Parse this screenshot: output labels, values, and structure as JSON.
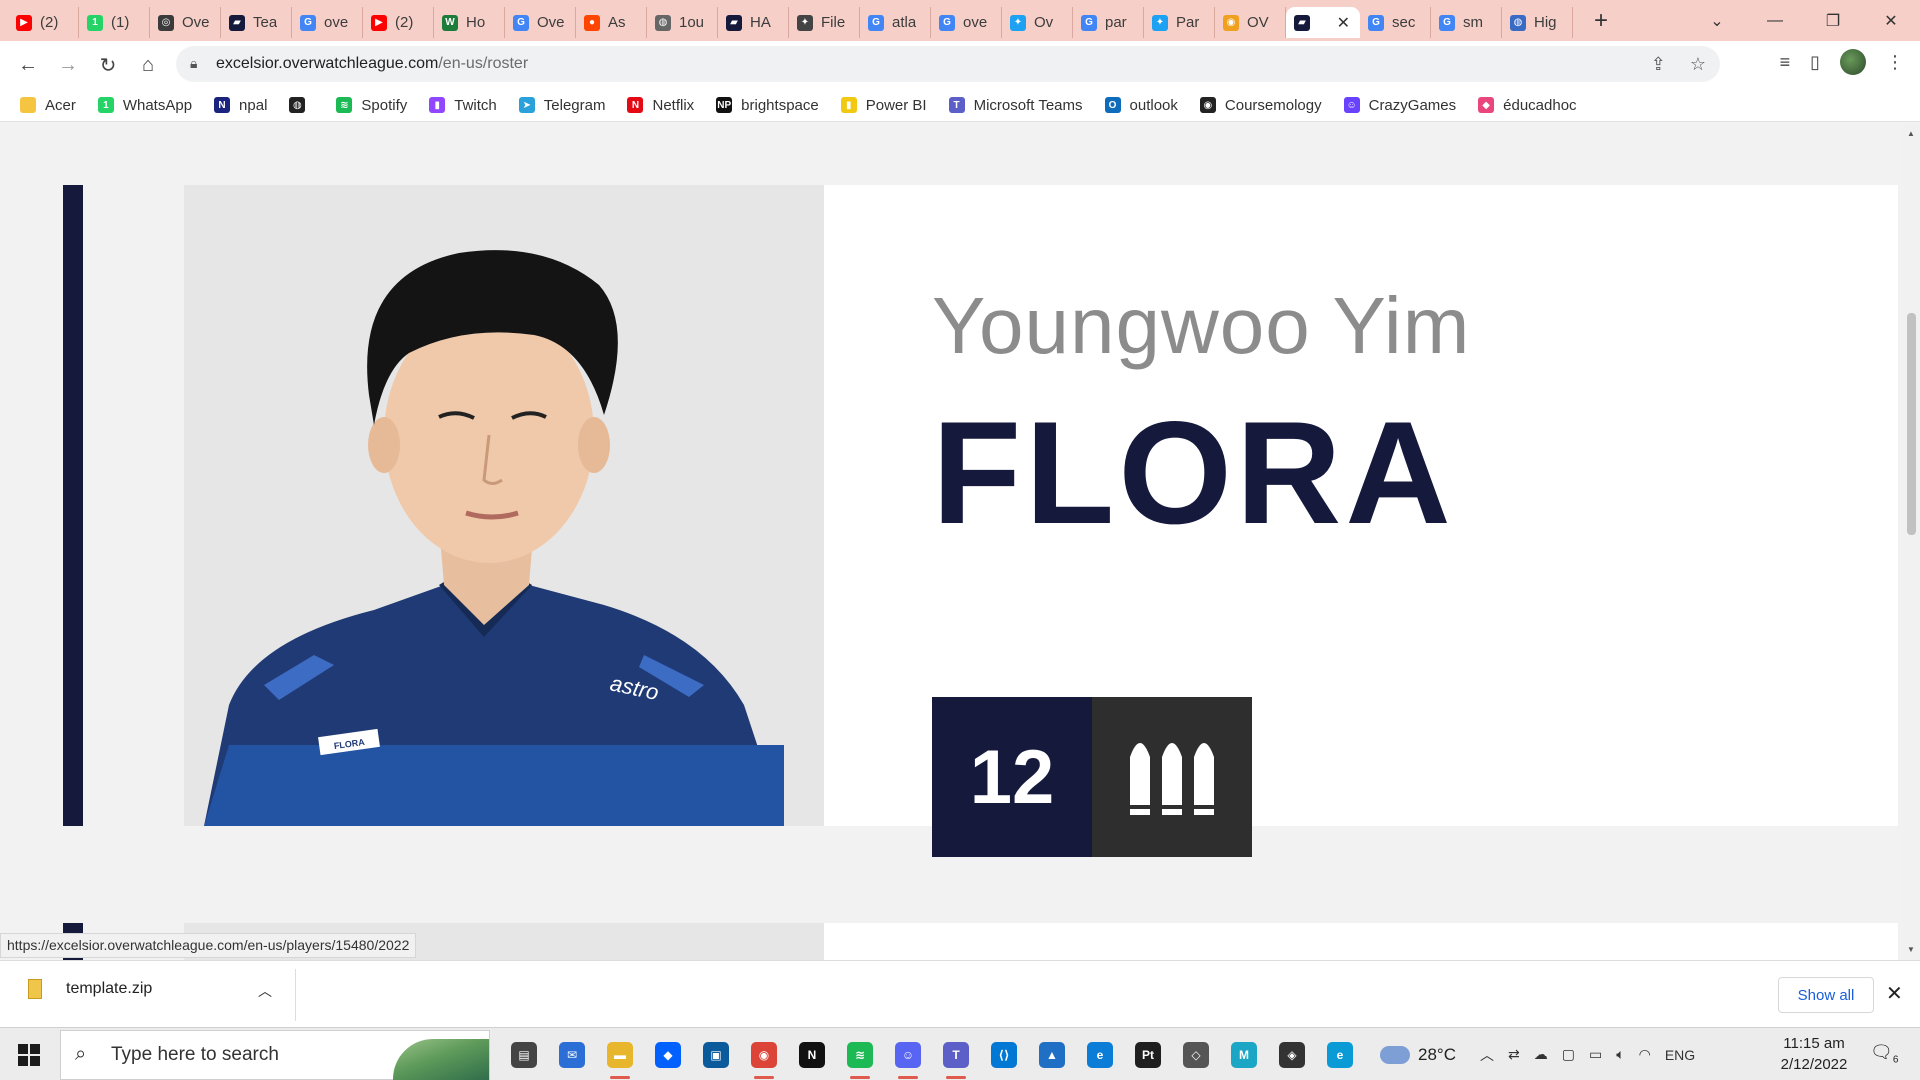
{
  "browser": {
    "tabs": [
      {
        "title": "(2)",
        "favicon": "youtube-icon",
        "color": "#ff0000",
        "glyph": "▶"
      },
      {
        "title": "(1)",
        "favicon": "whatsapp-icon",
        "color": "#25d366",
        "glyph": "1"
      },
      {
        "title": "Ove",
        "favicon": "overwatch-icon",
        "color": "#3b3b3b",
        "glyph": "◎"
      },
      {
        "title": "Tea",
        "favicon": "excelsior-icon",
        "color": "#151a3d",
        "glyph": "▰"
      },
      {
        "title": "ove",
        "favicon": "google-icon",
        "color": "#4285f4",
        "glyph": "G"
      },
      {
        "title": "(2)",
        "favicon": "youtube-icon",
        "color": "#ff0000",
        "glyph": "▶"
      },
      {
        "title": "Ho",
        "favicon": "wikihow-icon",
        "color": "#1e7c3a",
        "glyph": "W"
      },
      {
        "title": "Ove",
        "favicon": "google-icon",
        "color": "#4285f4",
        "glyph": "G"
      },
      {
        "title": "As",
        "favicon": "reddit-icon",
        "color": "#ff4500",
        "glyph": "●"
      },
      {
        "title": "1ou",
        "favicon": "globe-icon",
        "color": "#666666",
        "glyph": "◍"
      },
      {
        "title": "HA",
        "favicon": "excelsior-icon",
        "color": "#151a3d",
        "glyph": "▰"
      },
      {
        "title": "File",
        "favicon": "file-icon",
        "color": "#444444",
        "glyph": "✦"
      },
      {
        "title": "atla",
        "favicon": "google-icon",
        "color": "#4285f4",
        "glyph": "G"
      },
      {
        "title": "ove",
        "favicon": "google-icon",
        "color": "#4285f4",
        "glyph": "G"
      },
      {
        "title": "Ov",
        "favicon": "twitter-icon",
        "color": "#1da1f2",
        "glyph": "✦"
      },
      {
        "title": "par",
        "favicon": "google-icon",
        "color": "#4285f4",
        "glyph": "G"
      },
      {
        "title": "Par",
        "favicon": "twitter-icon",
        "color": "#1da1f2",
        "glyph": "✦"
      },
      {
        "title": "OV",
        "favicon": "overwatch-league-icon",
        "color": "#f0a020",
        "glyph": "◉"
      },
      {
        "title": "",
        "favicon": "excelsior-icon",
        "color": "#151a3d",
        "glyph": "▰",
        "active": true
      },
      {
        "title": "sec",
        "favicon": "google-icon",
        "color": "#4285f4",
        "glyph": "G"
      },
      {
        "title": "sm",
        "favicon": "google-icon",
        "color": "#4285f4",
        "glyph": "G"
      },
      {
        "title": "Hig",
        "favicon": "globe-icon",
        "color": "#3a6bc4",
        "glyph": "◍"
      }
    ],
    "new_tab": "+",
    "window_controls": {
      "dropdown": "⌄",
      "minimize": "—",
      "restore": "❐",
      "close": "✕"
    },
    "address": {
      "host": "excelsior.overwatchleague.com",
      "path": "/en-us/roster"
    },
    "bookmarks": [
      {
        "label": "Acer",
        "icon": "folder-icon",
        "color": "#f5c542",
        "glyph": ""
      },
      {
        "label": "WhatsApp",
        "icon": "whatsapp-icon",
        "color": "#25d366",
        "glyph": "1"
      },
      {
        "label": "npal",
        "icon": "npal-icon",
        "color": "#1a237e",
        "glyph": "N"
      },
      {
        "label": "",
        "icon": "globe-icon",
        "color": "#222222",
        "glyph": "◍"
      },
      {
        "label": "Spotify",
        "icon": "spotify-icon",
        "color": "#1db954",
        "glyph": "≋"
      },
      {
        "label": "Twitch",
        "icon": "twitch-icon",
        "color": "#9146ff",
        "glyph": "▮"
      },
      {
        "label": "Telegram",
        "icon": "telegram-icon",
        "color": "#2aa1da",
        "glyph": "➤"
      },
      {
        "label": "Netflix",
        "icon": "netflix-icon",
        "color": "#e50914",
        "glyph": "N"
      },
      {
        "label": "brightspace",
        "icon": "np-icon",
        "color": "#111111",
        "glyph": "NP"
      },
      {
        "label": "Power BI",
        "icon": "powerbi-icon",
        "color": "#f2c811",
        "glyph": "▮"
      },
      {
        "label": "Microsoft Teams",
        "icon": "teams-icon",
        "color": "#5b5fc7",
        "glyph": "T"
      },
      {
        "label": "outlook",
        "icon": "outlook-icon",
        "color": "#0f6cbd",
        "glyph": "O"
      },
      {
        "label": "Coursemology",
        "icon": "coursemology-icon",
        "color": "#222222",
        "glyph": "◉"
      },
      {
        "label": "CrazyGames",
        "icon": "crazygames-icon",
        "color": "#6842ff",
        "glyph": "☺"
      },
      {
        "label": "éducadhoc",
        "icon": "educadhoc-icon",
        "color": "#e8467c",
        "glyph": "◆"
      }
    ],
    "status_url": "https://excelsior.overwatchleague.com/en-us/players/15480/2022"
  },
  "player": {
    "real_name": "Youngwoo Yim",
    "handle": "FLORA",
    "number": "12",
    "role_icon": "support-role-icon",
    "jersey_name": "FLORA",
    "sponsor": "astro",
    "accent_color": "#151a3d",
    "role_bg_color": "#2e2e2e"
  },
  "downloads": {
    "file": "template.zip",
    "show_all": "Show all",
    "close": "✕"
  },
  "taskbar": {
    "search_placeholder": "Type here to search",
    "apps": [
      {
        "name": "task-view-icon",
        "color": "#444444",
        "glyph": "▤",
        "running": false
      },
      {
        "name": "mail-icon",
        "color": "#2b6fd6",
        "glyph": "✉",
        "running": false
      },
      {
        "name": "file-explorer-icon",
        "color": "#e8b62c",
        "glyph": "▬",
        "running": true
      },
      {
        "name": "dropbox-icon",
        "color": "#0061fe",
        "glyph": "◆",
        "running": false
      },
      {
        "name": "app-store-icon",
        "color": "#0a5a9c",
        "glyph": "▣",
        "running": false
      },
      {
        "name": "chrome-icon",
        "color": "#db4437",
        "glyph": "◉",
        "running": true
      },
      {
        "name": "netflix-icon",
        "color": "#111111",
        "glyph": "N",
        "running": false
      },
      {
        "name": "spotify-icon",
        "color": "#1db954",
        "glyph": "≋",
        "running": true
      },
      {
        "name": "discord-icon",
        "color": "#5865f2",
        "glyph": "☺",
        "running": true
      },
      {
        "name": "teams-icon",
        "color": "#5b5fc7",
        "glyph": "T",
        "running": true
      },
      {
        "name": "vscode-icon",
        "color": "#0078d4",
        "glyph": "⟨⟩",
        "running": false
      },
      {
        "name": "photos-icon",
        "color": "#1f6fc5",
        "glyph": "▲",
        "running": false
      },
      {
        "name": "edge-icon",
        "color": "#0c7dd6",
        "glyph": "e",
        "running": false
      },
      {
        "name": "pycharm-icon",
        "color": "#1f1f1f",
        "glyph": "Pt",
        "running": false
      },
      {
        "name": "unity-icon",
        "color": "#555555",
        "glyph": "◇",
        "running": false
      },
      {
        "name": "maya-icon",
        "color": "#1aa6c4",
        "glyph": "M",
        "running": false
      },
      {
        "name": "unity-hub-icon",
        "color": "#333333",
        "glyph": "◈",
        "running": false
      },
      {
        "name": "edge-dev-icon",
        "color": "#0a9bd6",
        "glyph": "e",
        "running": false
      }
    ],
    "weather": "28°C",
    "language": "ENG",
    "time": "11:15 am",
    "date": "2/12/2022",
    "notification_count": "6"
  }
}
